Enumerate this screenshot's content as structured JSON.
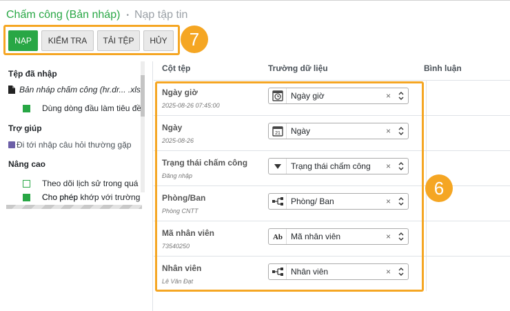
{
  "breadcrumb": {
    "current": "Chấm công (Bản nháp)",
    "separator": "•",
    "next": "Nạp tập tin"
  },
  "toolbar": {
    "load": "NẠP",
    "check": "KIỂM TRA",
    "upload": "TẢI TỆP",
    "cancel": "HỦY"
  },
  "badges": {
    "toolbar": "7",
    "fields": "6"
  },
  "sidebar": {
    "imported_title": "Tệp đã nhập",
    "file_name": "Bản nháp chấm công (hr.dr...   .xlsx",
    "first_row_header": "Dùng dòng đầu làm tiêu đề",
    "help_title": "Trợ giúp",
    "help_link": "Đi tới nhập câu hỏi thường gặp",
    "advanced_title": "Nâng cao",
    "track_history": "Theo dõi lịch sử trong quá",
    "allow_match": "Cho phép khớp với trường p",
    "allow_match_overlap": "Cho phép"
  },
  "columns": {
    "file_col": "Cột tệp",
    "field": "Trường dữ liệu",
    "comment": "Bình luận"
  },
  "rows": [
    {
      "label": "Ngày giờ",
      "sample": "2025-08-26 07:45:00",
      "icon": "clock-icon",
      "value": "Ngày giờ"
    },
    {
      "label": "Ngày",
      "sample": "2025-08-26",
      "icon": "calendar-icon",
      "value": "Ngày",
      "icon_text": "21"
    },
    {
      "label": "Trạng thái chấm công",
      "sample": "Đăng nhập",
      "icon": "dropdown-triangle-icon",
      "value": "Trạng thái chấm công"
    },
    {
      "label": "Phòng/Ban",
      "sample": "Phòng CNTT",
      "icon": "relation-icon",
      "value": "Phòng/ Ban"
    },
    {
      "label": "Mã nhân viên",
      "sample": "73540250",
      "icon": "text-field-icon",
      "value": "Mã nhân viên",
      "icon_text": "Ab"
    },
    {
      "label": "Nhân viên",
      "sample": "Lê Văn Đạt",
      "icon": "relation-icon",
      "value": "Nhân viên"
    }
  ],
  "field_clear": "×",
  "colors": {
    "accent_green": "#28a745",
    "highlight_orange": "#f5a623"
  }
}
